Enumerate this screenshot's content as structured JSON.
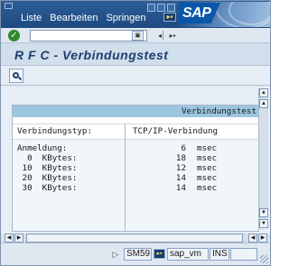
{
  "menu": {
    "items": [
      "Liste",
      "Bearbeiten",
      "Springen"
    ],
    "logo": "SAP"
  },
  "toolbar": {
    "command_value": "",
    "icons": [
      "enter-icon",
      "dropdown-icon",
      "back-icon",
      "new-session-icon"
    ]
  },
  "page_title": "R F C - Verbindungstest",
  "app_toolbar": {
    "icons": [
      "find-icon"
    ]
  },
  "list": {
    "header": "Verbindungstest",
    "type_label": "Verbindungstyp:",
    "type_value": "TCP/IP-Verbindung",
    "rows": [
      {
        "label": "Anmeldung:",
        "value": "6",
        "unit": "msec"
      },
      {
        "label": "  0  KBytes:",
        "value": "18",
        "unit": "msec"
      },
      {
        "label": " 10  KBytes:",
        "value": "12",
        "unit": "msec"
      },
      {
        "label": " 20  KBytes:",
        "value": "14",
        "unit": "msec"
      },
      {
        "label": " 30  KBytes:",
        "value": "14",
        "unit": "msec"
      }
    ]
  },
  "status": {
    "transaction": "SM59",
    "system": "sap_vm",
    "mode": "INS"
  }
}
